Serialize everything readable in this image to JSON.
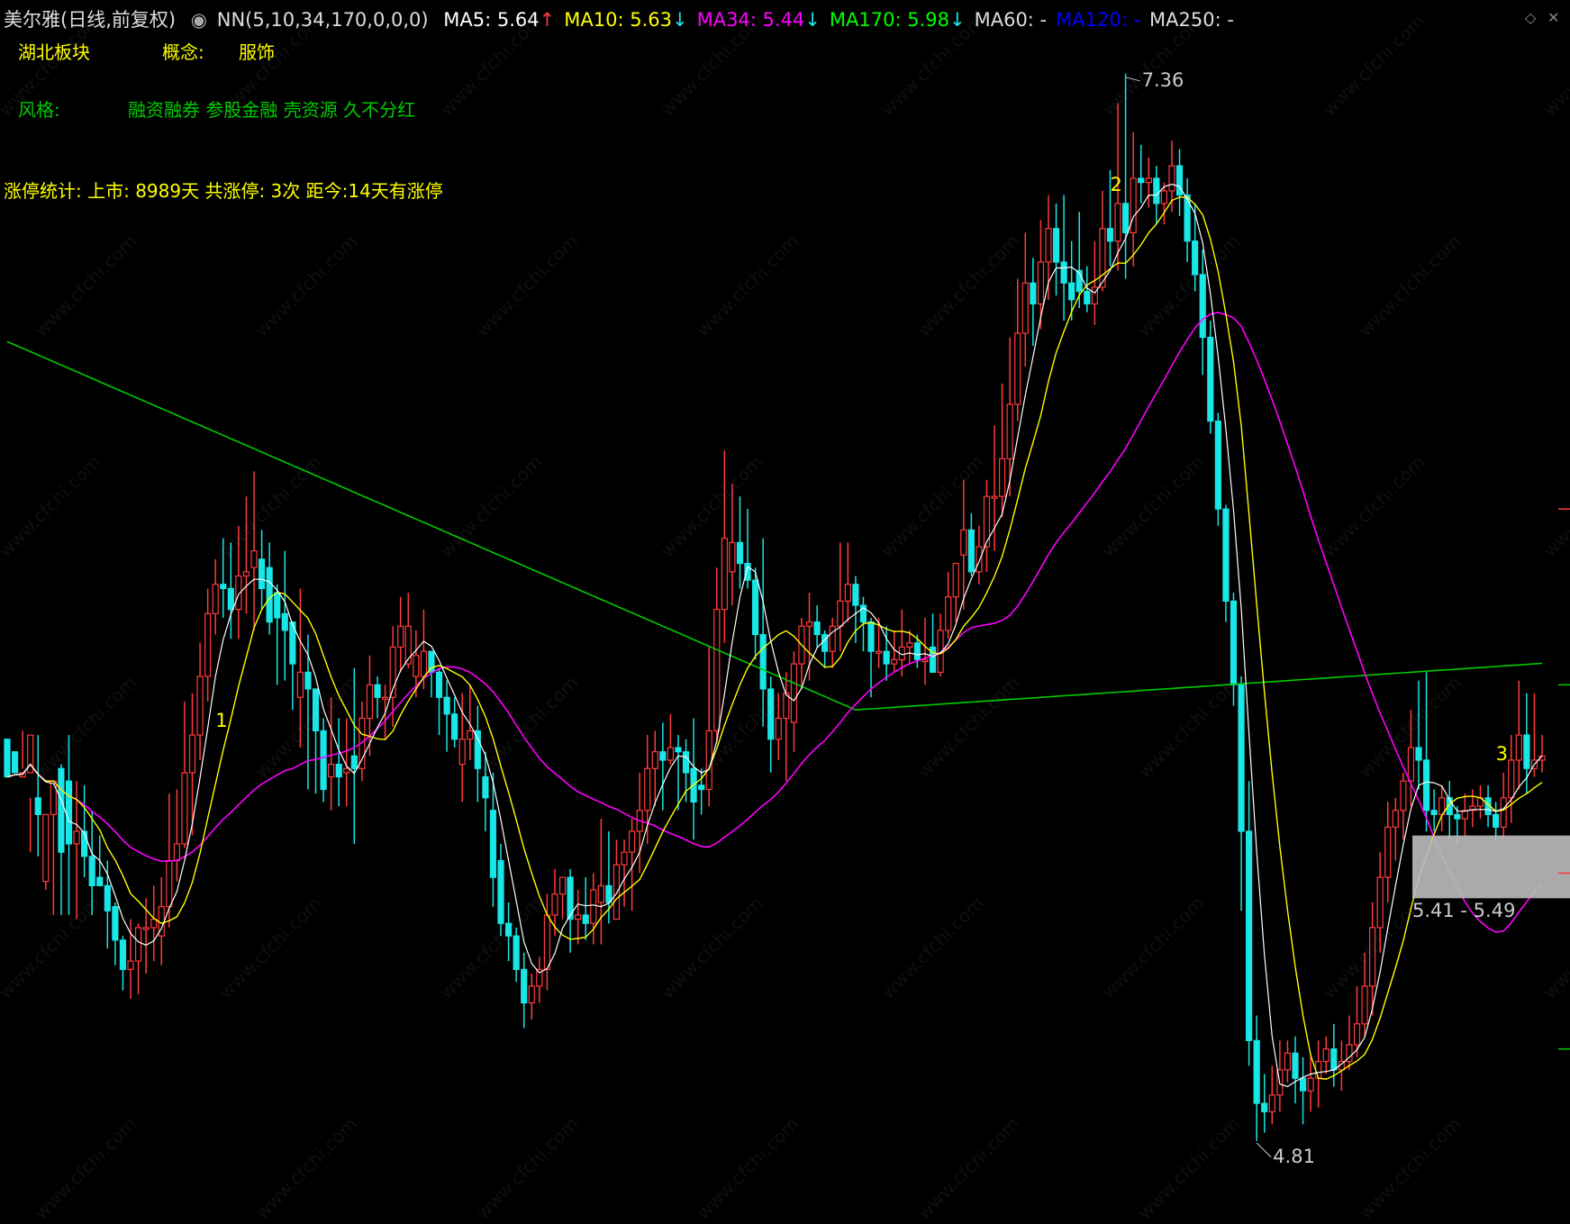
{
  "header": {
    "stock": "美尔雅(日线,前复权)",
    "indicator": "NN(5,10,34,170,0,0,0)",
    "ma_items": [
      {
        "label": "MA5: 5.64",
        "arrow": "↑",
        "color": "#ffffff",
        "arrow_color": "#ff3b3b"
      },
      {
        "label": "MA10: 5.63",
        "arrow": "↓",
        "color": "#ffff00",
        "arrow_color": "#19e6e6"
      },
      {
        "label": "MA34: 5.44",
        "arrow": "↓",
        "color": "#ff00ff",
        "arrow_color": "#19e6e6"
      },
      {
        "label": "MA170: 5.98",
        "arrow": "↓",
        "color": "#00ff00",
        "arrow_color": "#19e6e6"
      },
      {
        "label": "MA60: -",
        "arrow": "",
        "color": "#dddddd",
        "arrow_color": ""
      },
      {
        "label": "MA120: -",
        "arrow": "",
        "color": "#0000ff",
        "arrow_color": ""
      },
      {
        "label": "MA250: -",
        "arrow": "",
        "color": "#dddddd",
        "arrow_color": ""
      }
    ]
  },
  "info": {
    "board": "湖北板块",
    "concept_label": "概念:",
    "concept_value": "服饰",
    "style_label": "风格:",
    "style_value": "融资融券 参股金融 壳资源 久不分红",
    "limit_stats": "涨停统计:   上市: 8989天    共涨停: 3次    距今:14天有涨停"
  },
  "chart_data": {
    "type": "candlestick",
    "y_range": [
      4.7,
      7.45
    ],
    "high_label": "7.36",
    "low_label": "4.81",
    "range_label": "5.41 - 5.49",
    "range_band": [
      5.41,
      5.49
    ],
    "markers": [
      "1",
      "2",
      "3"
    ],
    "colors": {
      "up": "#ff3b3b",
      "down": "#19e6e6",
      "ma5": "#ffffff",
      "ma10": "#ffff00",
      "ma34": "#ff00ff",
      "ma170": "#00cc00"
    },
    "candles": [
      [
        5.77,
        5.68,
        5.69,
        5.76
      ],
      [
        5.74,
        5.69,
        5.7,
        5.71
      ],
      [
        5.68,
        5.69,
        5.7,
        5.79
      ],
      [
        5.69,
        5.78,
        5.5,
        5.63
      ],
      [
        5.63,
        5.59,
        5.49,
        5.78
      ],
      [
        5.43,
        5.59,
        5.41,
        5.57
      ],
      [
        5.59,
        5.67,
        5.35,
        5.62
      ],
      [
        5.7,
        5.5,
        5.35,
        5.71
      ],
      [
        5.67,
        5.52,
        5.35,
        5.78
      ],
      [
        5.52,
        5.55,
        5.34,
        5.67
      ],
      [
        5.55,
        5.49,
        5.44,
        5.66
      ],
      [
        5.49,
        5.42,
        5.35,
        5.6
      ],
      [
        5.44,
        5.42,
        5.42,
        5.54
      ],
      [
        5.42,
        5.36,
        5.27,
        5.48
      ],
      [
        5.37,
        5.29,
        5.23,
        5.38
      ],
      [
        5.29,
        5.22,
        5.17,
        5.3
      ],
      [
        5.22,
        5.24,
        5.15,
        5.34
      ],
      [
        5.24,
        5.32,
        5.16,
        5.33
      ],
      [
        5.32,
        5.32,
        5.21,
        5.39
      ],
      [
        5.32,
        5.34,
        5.24,
        5.42
      ],
      [
        5.3,
        5.37,
        5.23,
        5.44
      ],
      [
        5.37,
        5.48,
        5.32,
        5.64
      ],
      [
        5.48,
        5.52,
        5.43,
        5.65
      ],
      [
        5.52,
        5.69,
        5.51,
        5.86
      ],
      [
        5.69,
        5.78,
        5.54,
        5.88
      ],
      [
        5.78,
        5.92,
        5.72,
        6.0
      ],
      [
        5.92,
        6.07,
        5.86,
        6.13
      ],
      [
        6.07,
        6.14,
        6.02,
        6.2
      ],
      [
        6.14,
        6.13,
        6.06,
        6.25
      ],
      [
        6.13,
        6.08,
        6.01,
        6.24
      ],
      [
        6.08,
        6.16,
        6.01,
        6.28
      ],
      [
        6.16,
        6.17,
        6.07,
        6.35
      ],
      [
        6.18,
        6.22,
        6.03,
        6.41
      ],
      [
        6.2,
        6.13,
        6.08,
        6.27
      ],
      [
        6.18,
        6.05,
        6.02,
        6.24
      ],
      [
        6.12,
        6.06,
        5.9,
        6.14
      ],
      [
        6.07,
        6.03,
        5.91,
        6.22
      ],
      [
        6.05,
        5.95,
        5.84,
        6.05
      ],
      [
        5.87,
        5.93,
        5.75,
        6.13
      ],
      [
        5.93,
        5.89,
        5.65,
        6.02
      ],
      [
        5.89,
        5.79,
        5.64,
        5.88
      ],
      [
        5.79,
        5.65,
        5.62,
        5.82
      ],
      [
        5.68,
        5.71,
        5.6,
        5.87
      ],
      [
        5.71,
        5.68,
        5.61,
        5.82
      ],
      [
        5.69,
        5.7,
        5.61,
        5.82
      ],
      [
        5.73,
        5.7,
        5.52,
        5.94
      ],
      [
        5.7,
        5.82,
        5.67,
        5.86
      ],
      [
        5.82,
        5.9,
        5.73,
        5.97
      ],
      [
        5.9,
        5.87,
        5.82,
        5.92
      ],
      [
        5.87,
        5.87,
        5.77,
        5.9
      ],
      [
        5.87,
        5.99,
        5.8,
        6.04
      ],
      [
        5.99,
        6.04,
        5.93,
        6.11
      ],
      [
        5.95,
        6.04,
        5.94,
        6.12
      ],
      [
        5.92,
        5.97,
        5.87,
        6.03
      ],
      [
        5.92,
        5.98,
        5.89,
        6.08
      ],
      [
        5.98,
        5.93,
        5.87,
        5.98
      ],
      [
        5.93,
        5.87,
        5.78,
        5.94
      ],
      [
        5.87,
        5.83,
        5.74,
        5.91
      ],
      [
        5.83,
        5.77,
        5.75,
        5.87
      ],
      [
        5.71,
        5.77,
        5.62,
        5.88
      ],
      [
        5.77,
        5.79,
        5.72,
        5.9
      ],
      [
        5.79,
        5.7,
        5.62,
        5.85
      ],
      [
        5.68,
        5.63,
        5.55,
        5.74
      ],
      [
        5.6,
        5.44,
        5.37,
        5.69
      ],
      [
        5.48,
        5.33,
        5.3,
        5.52
      ],
      [
        5.33,
        5.3,
        5.24,
        5.38
      ],
      [
        5.3,
        5.22,
        5.19,
        5.32
      ],
      [
        5.22,
        5.14,
        5.08,
        5.26
      ],
      [
        5.14,
        5.18,
        5.1,
        5.21
      ],
      [
        5.18,
        5.22,
        5.14,
        5.25
      ],
      [
        5.22,
        5.35,
        5.17,
        5.4
      ],
      [
        5.35,
        5.4,
        5.3,
        5.46
      ],
      [
        5.4,
        5.44,
        5.34,
        5.43
      ],
      [
        5.44,
        5.34,
        5.26,
        5.46
      ],
      [
        5.34,
        5.35,
        5.28,
        5.41
      ],
      [
        5.35,
        5.33,
        5.29,
        5.44
      ],
      [
        5.33,
        5.41,
        5.28,
        5.45
      ],
      [
        5.38,
        5.42,
        5.28,
        5.58
      ],
      [
        5.42,
        5.38,
        5.33,
        5.55
      ],
      [
        5.34,
        5.47,
        5.34,
        5.53
      ],
      [
        5.47,
        5.5,
        5.37,
        5.53
      ],
      [
        5.5,
        5.55,
        5.36,
        5.58
      ],
      [
        5.55,
        5.6,
        5.45,
        5.69
      ],
      [
        5.6,
        5.7,
        5.52,
        5.78
      ],
      [
        5.7,
        5.74,
        5.61,
        5.79
      ],
      [
        5.74,
        5.72,
        5.6,
        5.81
      ],
      [
        5.72,
        5.75,
        5.71,
        5.83
      ],
      [
        5.75,
        5.74,
        5.6,
        5.78
      ],
      [
        5.74,
        5.69,
        5.62,
        5.77
      ],
      [
        5.7,
        5.62,
        5.53,
        5.82
      ],
      [
        5.66,
        5.65,
        5.59,
        5.7
      ],
      [
        5.65,
        5.79,
        5.61,
        5.99
      ],
      [
        5.79,
        6.08,
        5.76,
        6.18
      ],
      [
        6.08,
        6.25,
        6.0,
        6.46
      ],
      [
        6.17,
        6.24,
        6.09,
        6.38
      ],
      [
        6.24,
        6.19,
        6.13,
        6.35
      ],
      [
        6.19,
        6.15,
        6.13,
        6.32
      ],
      [
        6.15,
        6.02,
        5.96,
        6.18
      ],
      [
        6.02,
        5.89,
        5.8,
        6.25
      ],
      [
        5.89,
        5.77,
        5.69,
        5.92
      ],
      [
        5.77,
        5.82,
        5.72,
        5.88
      ],
      [
        5.82,
        5.88,
        5.67,
        5.93
      ],
      [
        5.81,
        5.95,
        5.74,
        5.98
      ],
      [
        5.95,
        6.04,
        5.89,
        6.06
      ],
      [
        6.04,
        6.05,
        5.91,
        6.12
      ],
      [
        6.05,
        6.02,
        5.99,
        6.09
      ],
      [
        6.02,
        5.98,
        5.94,
        6.03
      ],
      [
        5.98,
        6.04,
        5.94,
        6.06
      ],
      [
        6.04,
        6.1,
        5.98,
        6.24
      ],
      [
        6.1,
        6.14,
        6.05,
        6.24
      ],
      [
        6.14,
        6.09,
        6.0,
        6.16
      ],
      [
        6.09,
        6.05,
        5.98,
        6.11
      ],
      [
        6.05,
        5.98,
        5.87,
        6.06
      ],
      [
        5.98,
        5.98,
        5.94,
        6.06
      ],
      [
        5.98,
        5.95,
        5.91,
        6.04
      ],
      [
        5.95,
        5.96,
        5.93,
        6.03
      ],
      [
        5.96,
        5.99,
        5.92,
        6.08
      ],
      [
        5.99,
        6.0,
        5.95,
        6.03
      ],
      [
        6.0,
        5.96,
        5.94,
        6.02
      ],
      [
        5.96,
        5.96,
        5.9,
        6.06
      ],
      [
        5.99,
        5.93,
        5.93,
        6.07
      ],
      [
        5.93,
        6.03,
        5.92,
        6.07
      ],
      [
        6.03,
        6.11,
        6.01,
        6.17
      ],
      [
        6.11,
        6.19,
        6.05,
        6.19
      ],
      [
        6.21,
        6.27,
        6.08,
        6.39
      ],
      [
        6.27,
        6.17,
        6.16,
        6.31
      ],
      [
        6.17,
        6.23,
        6.14,
        6.28
      ],
      [
        6.23,
        6.35,
        6.17,
        6.39
      ],
      [
        6.35,
        6.35,
        6.22,
        6.52
      ],
      [
        6.35,
        6.44,
        6.3,
        6.62
      ],
      [
        6.44,
        6.57,
        6.35,
        6.73
      ],
      [
        6.57,
        6.74,
        6.53,
        6.87
      ],
      [
        6.74,
        6.86,
        6.66,
        6.98
      ],
      [
        6.86,
        6.81,
        6.71,
        6.92
      ],
      [
        6.81,
        6.91,
        6.75,
        7.01
      ],
      [
        6.91,
        6.99,
        6.82,
        7.07
      ],
      [
        6.99,
        6.91,
        6.83,
        7.05
      ],
      [
        6.91,
        6.86,
        6.77,
        7.07
      ],
      [
        6.86,
        6.82,
        6.77,
        6.96
      ],
      [
        6.89,
        6.84,
        6.8,
        7.03
      ],
      [
        6.84,
        6.81,
        6.79,
        6.9
      ],
      [
        6.81,
        6.85,
        6.76,
        6.96
      ],
      [
        6.85,
        6.99,
        6.84,
        7.08
      ],
      [
        6.99,
        6.96,
        6.9,
        7.13
      ],
      [
        6.96,
        7.05,
        6.89,
        7.29
      ],
      [
        7.05,
        6.98,
        6.87,
        7.36
      ],
      [
        6.98,
        7.11,
        6.9,
        7.22
      ],
      [
        7.11,
        7.1,
        7.05,
        7.19
      ],
      [
        7.1,
        7.11,
        7.04,
        7.16
      ],
      [
        7.11,
        7.05,
        7.0,
        7.14
      ],
      [
        7.05,
        7.08,
        7.0,
        7.1
      ],
      [
        7.08,
        7.14,
        7.03,
        7.2
      ],
      [
        7.14,
        7.07,
        7.02,
        7.18
      ],
      [
        7.07,
        6.96,
        6.91,
        7.11
      ],
      [
        6.96,
        6.88,
        6.84,
        7.05
      ],
      [
        6.88,
        6.73,
        6.64,
        6.94
      ],
      [
        6.73,
        6.53,
        6.5,
        6.77
      ],
      [
        6.53,
        6.32,
        6.28,
        6.55
      ],
      [
        6.32,
        6.1,
        6.05,
        6.33
      ],
      [
        6.1,
        5.9,
        5.85,
        6.12
      ],
      [
        5.9,
        5.55,
        5.36,
        5.92
      ],
      [
        5.55,
        5.05,
        4.99,
        5.67
      ],
      [
        5.05,
        4.9,
        4.81,
        5.11
      ],
      [
        4.9,
        4.88,
        4.83,
        4.97
      ],
      [
        4.88,
        4.92,
        4.85,
        4.99
      ],
      [
        4.92,
        4.98,
        4.88,
        5.05
      ],
      [
        4.98,
        5.02,
        4.95,
        5.05
      ],
      [
        5.02,
        4.96,
        4.9,
        5.06
      ],
      [
        4.96,
        4.93,
        4.85,
        5.01
      ],
      [
        4.93,
        4.96,
        4.88,
        5.02
      ],
      [
        4.96,
        5.0,
        4.89,
        5.05
      ],
      [
        5.0,
        5.03,
        4.97,
        5.06
      ],
      [
        5.03,
        4.98,
        4.94,
        5.09
      ],
      [
        4.98,
        5.0,
        4.93,
        5.05
      ],
      [
        5.0,
        5.04,
        4.98,
        5.11
      ],
      [
        5.04,
        5.09,
        5.01,
        5.18
      ],
      [
        5.09,
        5.18,
        5.06,
        5.26
      ],
      [
        5.18,
        5.32,
        5.11,
        5.38
      ],
      [
        5.32,
        5.44,
        5.26,
        5.5
      ],
      [
        5.44,
        5.56,
        5.38,
        5.62
      ],
      [
        5.56,
        5.6,
        5.48,
        5.63
      ],
      [
        5.6,
        5.67,
        5.53,
        5.69
      ],
      [
        5.67,
        5.75,
        5.61,
        5.84
      ],
      [
        5.75,
        5.72,
        5.65,
        5.91
      ],
      [
        5.72,
        5.6,
        5.55,
        5.93
      ],
      [
        5.6,
        5.59,
        5.55,
        5.65
      ],
      [
        5.59,
        5.63,
        5.55,
        5.66
      ],
      [
        5.63,
        5.59,
        5.53,
        5.67
      ],
      [
        5.59,
        5.58,
        5.52,
        5.61
      ],
      [
        5.58,
        5.6,
        5.54,
        5.64
      ],
      [
        5.6,
        5.61,
        5.56,
        5.65
      ],
      [
        5.61,
        5.63,
        5.58,
        5.66
      ],
      [
        5.63,
        5.59,
        5.56,
        5.66
      ],
      [
        5.59,
        5.56,
        5.53,
        5.62
      ],
      [
        5.56,
        5.63,
        5.53,
        5.69
      ],
      [
        5.63,
        5.72,
        5.57,
        5.78
      ],
      [
        5.72,
        5.78,
        5.65,
        5.91
      ],
      [
        5.78,
        5.7,
        5.64,
        5.88
      ],
      [
        5.7,
        5.72,
        5.68,
        5.88
      ],
      [
        5.72,
        5.73,
        5.69,
        5.78
      ]
    ]
  },
  "watermark": "www.cfchi.com"
}
